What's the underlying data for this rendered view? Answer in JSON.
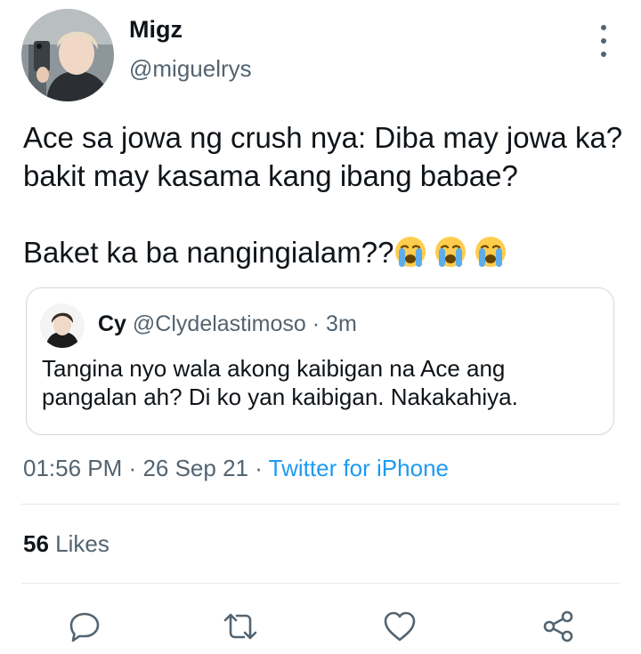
{
  "tweet": {
    "author_name": "Migz",
    "author_handle": "@miguelrys",
    "text_line1": "Ace sa jowa ng crush nya: Diba may jowa ka? bakit may kasama kang ibang babae?",
    "text_line2": "Baket ka ba nangingialam??",
    "emojis": [
      "loudly-crying-face",
      "loudly-crying-face",
      "loudly-crying-face"
    ],
    "time": "01:56 PM",
    "sep1": "·",
    "date": "26 Sep 21",
    "sep2": "·",
    "source": "Twitter for iPhone",
    "likes_count": "56",
    "likes_label": "Likes"
  },
  "quoted": {
    "name": "Cy",
    "handle": "@Clydelastimoso",
    "sep": "·",
    "age": "3m",
    "text": "Tangina nyo wala akong kaibigan na Ace ang pangalan ah? Di ko yan kaibigan. Nakakahiya."
  },
  "actions": [
    {
      "icon": "reply-icon"
    },
    {
      "icon": "retweet-icon"
    },
    {
      "icon": "like-icon"
    },
    {
      "icon": "share-icon"
    }
  ],
  "colors": {
    "text": "#0f1419",
    "secondary": "#536471",
    "link": "#1d9bf0",
    "border": "#cfd9de"
  }
}
